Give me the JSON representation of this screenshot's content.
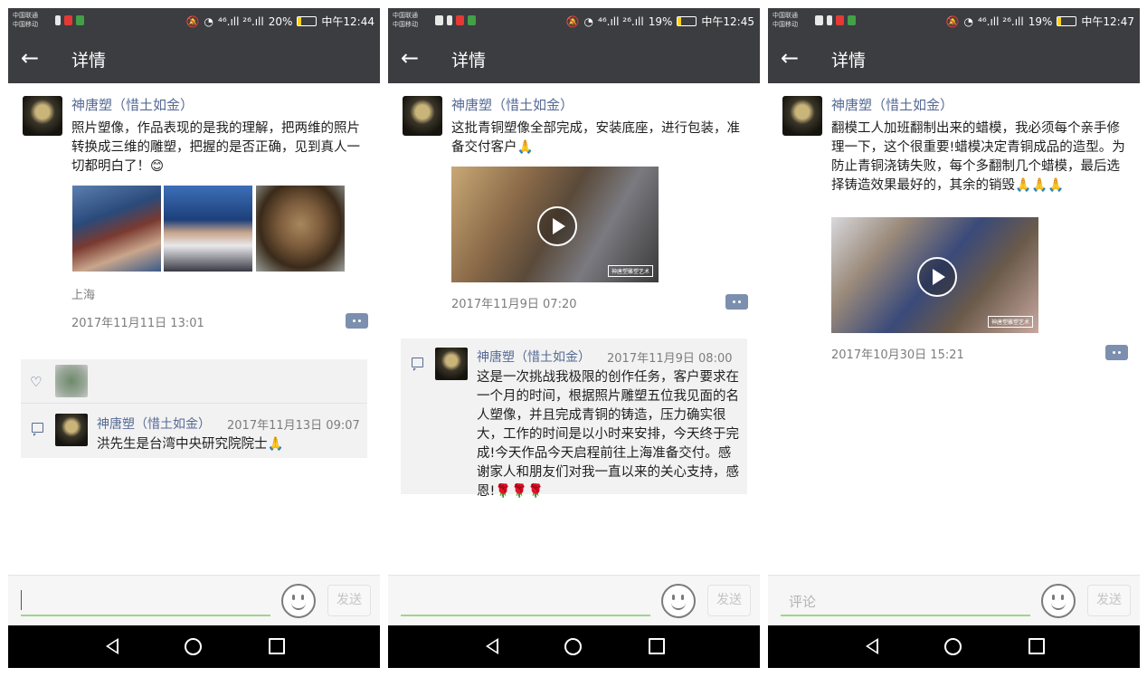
{
  "screens": [
    {
      "status": {
        "carrier1": "中国联通",
        "carrier2": "中国移动",
        "signal": "⁴⁶.ıll ²⁶.ıll",
        "battery": "20%",
        "time": "中午12:44",
        "battery_level": 0.2
      },
      "header": {
        "back_icon": "←",
        "title": "详情"
      },
      "post": {
        "author": "神唐塑（惜土如金）",
        "text": "照片塑像，作品表现的是我的理解，把两维的照片转换成三维的雕塑，把握的是否正确，见到真人一切都明白了！😊",
        "location": "上海",
        "time": "2017年11月11日 13:01"
      },
      "like_icon": "♡",
      "comment": {
        "author": "神唐塑（惜土如金）",
        "time": "2017年11月13日 09:07",
        "text": "洪先生是台湾中央研究院院士🙏"
      },
      "input": {
        "placeholder": "",
        "send": "发送"
      }
    },
    {
      "status": {
        "carrier1": "中国联通",
        "carrier2": "中国移动",
        "signal": "⁴⁶.ıll ²⁶.ıll",
        "battery": "19%",
        "time": "中午12:45",
        "battery_level": 0.19
      },
      "header": {
        "back_icon": "←",
        "title": "详情"
      },
      "post": {
        "author": "神唐塑（惜土如金）",
        "text": "这批青铜塑像全部完成，安装底座，进行包装，准备交付客户🙏",
        "time": "2017年11月9日 07:20",
        "watermark": "神唐塑雕塑艺术"
      },
      "comment": {
        "author": "神唐塑（惜土如金）",
        "time": "2017年11月9日 08:00",
        "text": "这是一次挑战我极限的创作任务，客户要求在一个月的时间，根据照片雕塑五位我见面的名人塑像，并且完成青铜的铸造，压力确实很大，工作的时间是以小时来安排，今天终于完成!今天作品今天启程前往上海准备交付。感谢家人和朋友们对我一直以来的关心支持，感恩!🌹🌹🌹"
      },
      "input": {
        "placeholder": "",
        "send": "发送"
      }
    },
    {
      "status": {
        "carrier1": "中国联通",
        "carrier2": "中国移动",
        "signal": "⁴⁶.ıll ²⁶.ıll",
        "battery": "19%",
        "time": "中午12:47",
        "battery_level": 0.19
      },
      "header": {
        "back_icon": "←",
        "title": "详情"
      },
      "post": {
        "author": "神唐塑（惜土如金）",
        "text": "翻模工人加班翻制出来的蜡模，我必须每个亲手修理一下，这个很重要!蜡模决定青铜成品的造型。为防止青铜浇铸失败，每个多翻制几个蜡模，最后选择铸造效果最好的，其余的销毁🙏🙏🙏",
        "time": "2017年10月30日 15:21",
        "watermark": "神唐塑雕塑艺术"
      },
      "input": {
        "placeholder": "评论",
        "send": "发送"
      }
    }
  ],
  "colors": {
    "header_bg": "#3b3d40",
    "link": "#566b95",
    "accent_green": "#9fd58a"
  }
}
